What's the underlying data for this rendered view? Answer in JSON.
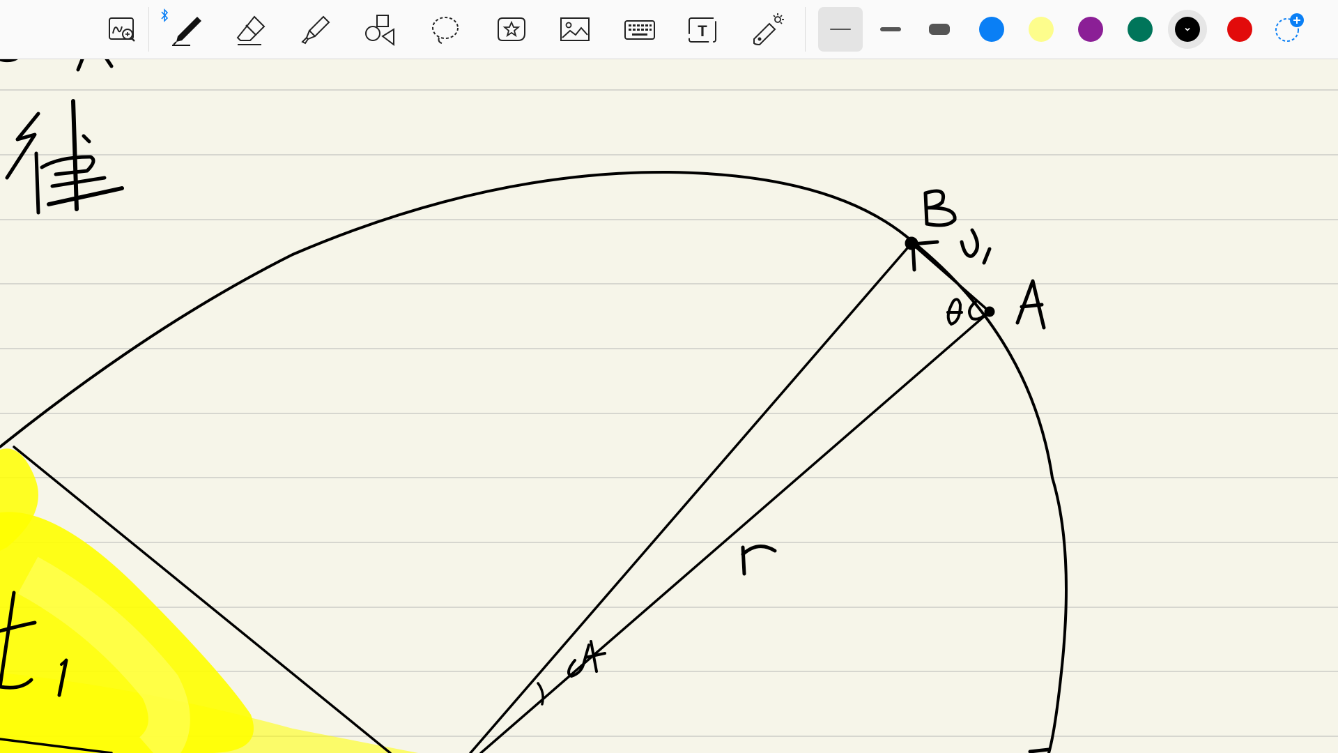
{
  "toolbar": {
    "tools": [
      {
        "name": "zoom-handwriting-tool",
        "icon": "zoom-handwriting-icon"
      },
      {
        "name": "pen-tool",
        "icon": "pen-icon",
        "active": true
      },
      {
        "name": "eraser-tool",
        "icon": "eraser-icon"
      },
      {
        "name": "highlighter-tool",
        "icon": "highlighter-icon"
      },
      {
        "name": "shapes-tool",
        "icon": "shapes-icon"
      },
      {
        "name": "lasso-tool",
        "icon": "lasso-icon"
      },
      {
        "name": "sticker-tool",
        "icon": "star-sticker-icon"
      },
      {
        "name": "image-tool",
        "icon": "image-icon"
      },
      {
        "name": "keyboard-tool",
        "icon": "keyboard-icon"
      },
      {
        "name": "text-tool",
        "icon": "text-box-icon",
        "glyph": "T"
      },
      {
        "name": "laser-pointer-tool",
        "icon": "laser-pointer-icon"
      }
    ],
    "stroke_widths": [
      "thin",
      "medium",
      "thick"
    ],
    "selected_stroke": "thin",
    "colors": [
      {
        "name": "blue",
        "hex": "#0a7ff5"
      },
      {
        "name": "yellow",
        "hex": "#fdfd8c"
      },
      {
        "name": "purple",
        "hex": "#8b1f96"
      },
      {
        "name": "green",
        "hex": "#00755a"
      },
      {
        "name": "black",
        "hex": "#000000",
        "selected": true
      },
      {
        "name": "red",
        "hex": "#e20b0b"
      }
    ],
    "accent": "#0a7ff5"
  },
  "canvas": {
    "paper_color": "#f6f5e9",
    "rule_color": "#d6d6cf",
    "highlight_color": "#ffff00",
    "ink_color": "#000000"
  }
}
